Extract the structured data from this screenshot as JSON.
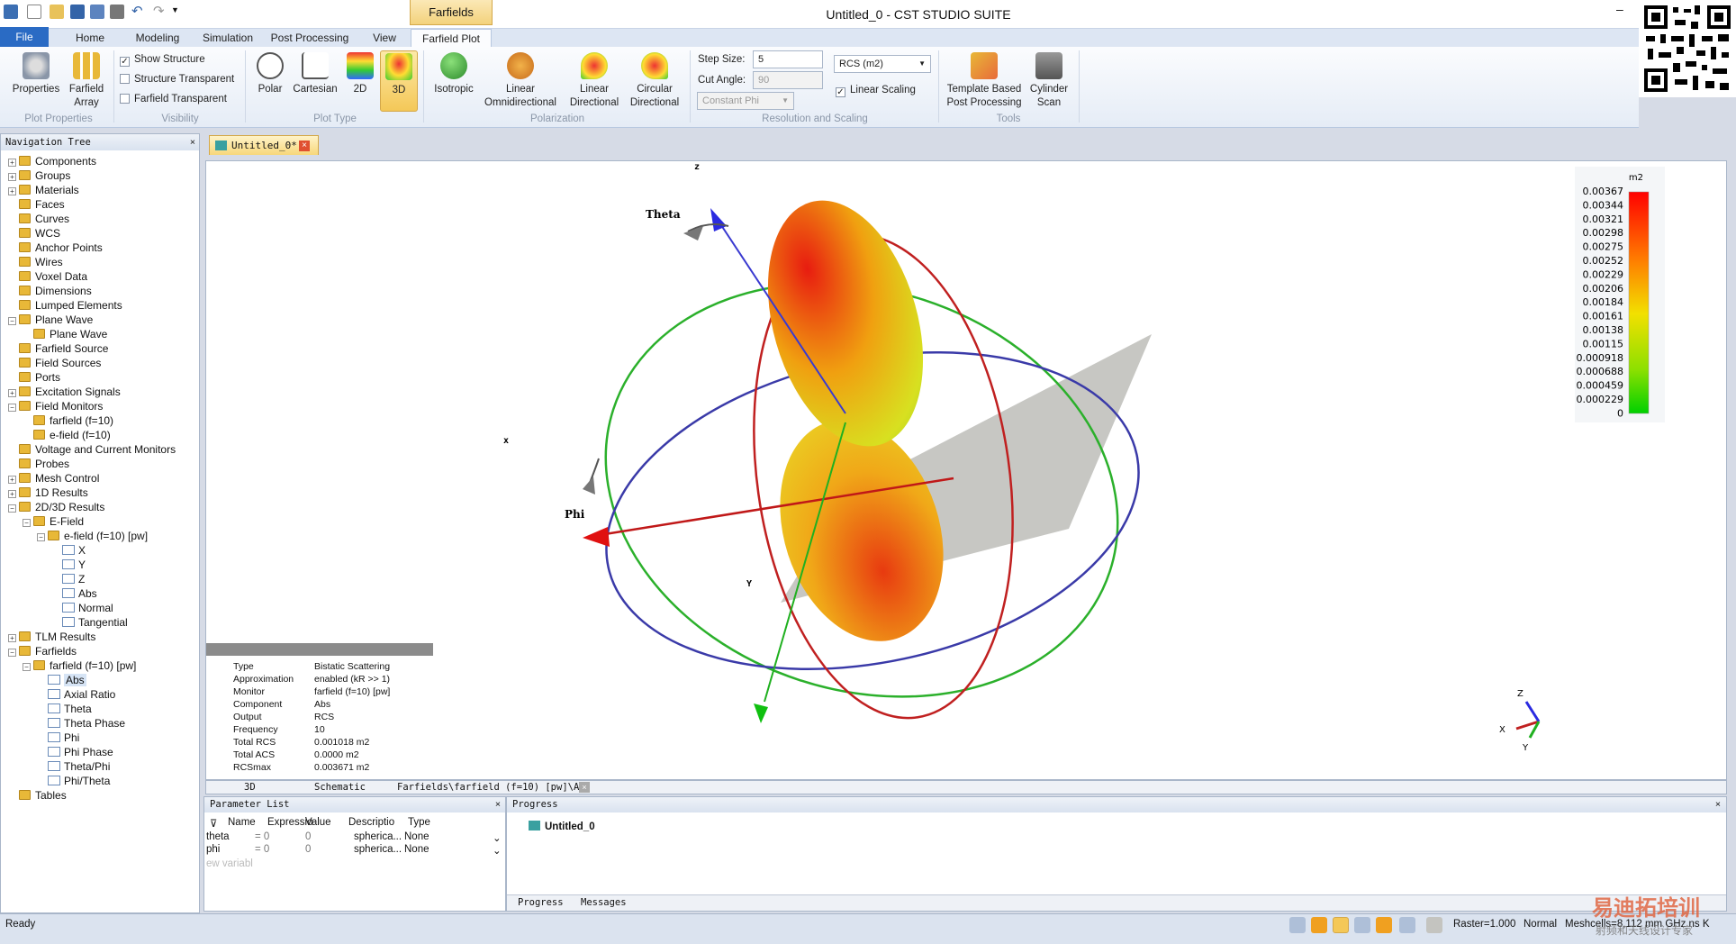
{
  "title_bar": {
    "app_title": "Untitled_0 - CST STUDIO SUITE",
    "context_tab": "Farfields",
    "minimize": "–"
  },
  "menu": {
    "file": "File",
    "tabs": [
      "Home",
      "Modeling",
      "Simulation",
      "Post Processing",
      "View",
      "Farfield Plot"
    ],
    "active": "Farfield Plot"
  },
  "ribbon": {
    "plot_properties": {
      "buttons": [
        "Properties",
        "Farfield Array"
      ],
      "group": "Plot Properties"
    },
    "visibility": {
      "checks": [
        {
          "label": "Show Structure",
          "checked": true
        },
        {
          "label": "Structure Transparent",
          "checked": false
        },
        {
          "label": "Farfield Transparent",
          "checked": false
        }
      ],
      "group": "Visibility"
    },
    "plot_type": {
      "buttons": [
        "Polar",
        "Cartesian",
        "2D",
        "3D"
      ],
      "active": "3D",
      "group": "Plot Type"
    },
    "polarization": {
      "buttons": [
        "Isotropic",
        "Linear Omnidirectional",
        "Linear Directional",
        "Circular Directional"
      ],
      "group": "Polarization"
    },
    "resolution": {
      "step_label": "Step Size:",
      "step_value": "5",
      "cut_label": "Cut Angle:",
      "cut_value": "90",
      "constant": "Constant Phi",
      "unit": "RCS (m2)",
      "linear_scaling": "Linear Scaling",
      "linear_checked": true,
      "group": "Resolution and Scaling"
    },
    "tools": {
      "buttons": [
        "Template Based Post Processing",
        "Cylinder Scan"
      ],
      "group": "Tools"
    }
  },
  "nav": {
    "title": "Navigation Tree",
    "items": [
      {
        "t": "Components",
        "l": 0,
        "e": "+"
      },
      {
        "t": "Groups",
        "l": 0,
        "e": "+"
      },
      {
        "t": "Materials",
        "l": 0,
        "e": "+"
      },
      {
        "t": "Faces",
        "l": 0,
        "e": ""
      },
      {
        "t": "Curves",
        "l": 0,
        "e": ""
      },
      {
        "t": "WCS",
        "l": 0,
        "e": ""
      },
      {
        "t": "Anchor Points",
        "l": 0,
        "e": ""
      },
      {
        "t": "Wires",
        "l": 0,
        "e": ""
      },
      {
        "t": "Voxel Data",
        "l": 0,
        "e": ""
      },
      {
        "t": "Dimensions",
        "l": 0,
        "e": ""
      },
      {
        "t": "Lumped Elements",
        "l": 0,
        "e": ""
      },
      {
        "t": "Plane Wave",
        "l": 0,
        "e": "-"
      },
      {
        "t": "Plane Wave",
        "l": 1,
        "e": ""
      },
      {
        "t": "Farfield Source",
        "l": 0,
        "e": ""
      },
      {
        "t": "Field Sources",
        "l": 0,
        "e": ""
      },
      {
        "t": "Ports",
        "l": 0,
        "e": ""
      },
      {
        "t": "Excitation Signals",
        "l": 0,
        "e": "+"
      },
      {
        "t": "Field Monitors",
        "l": 0,
        "e": "-"
      },
      {
        "t": "farfield (f=10)",
        "l": 1,
        "e": ""
      },
      {
        "t": "e-field (f=10)",
        "l": 1,
        "e": ""
      },
      {
        "t": "Voltage and Current Monitors",
        "l": 0,
        "e": ""
      },
      {
        "t": "Probes",
        "l": 0,
        "e": ""
      },
      {
        "t": "Mesh Control",
        "l": 0,
        "e": "+"
      },
      {
        "t": "1D Results",
        "l": 0,
        "e": "+"
      },
      {
        "t": "2D/3D Results",
        "l": 0,
        "e": "-"
      },
      {
        "t": "E-Field",
        "l": 1,
        "e": "-"
      },
      {
        "t": "e-field (f=10) [pw]",
        "l": 2,
        "e": "-"
      },
      {
        "t": "X",
        "l": 3,
        "e": ""
      },
      {
        "t": "Y",
        "l": 3,
        "e": ""
      },
      {
        "t": "Z",
        "l": 3,
        "e": ""
      },
      {
        "t": "Abs",
        "l": 3,
        "e": ""
      },
      {
        "t": "Normal",
        "l": 3,
        "e": ""
      },
      {
        "t": "Tangential",
        "l": 3,
        "e": ""
      },
      {
        "t": "TLM Results",
        "l": 0,
        "e": "+"
      },
      {
        "t": "Farfields",
        "l": 0,
        "e": "-"
      },
      {
        "t": "farfield (f=10) [pw]",
        "l": 1,
        "e": "-"
      },
      {
        "t": "Abs",
        "l": 2,
        "e": "",
        "sel": true
      },
      {
        "t": "Axial Ratio",
        "l": 2,
        "e": ""
      },
      {
        "t": "Theta",
        "l": 2,
        "e": ""
      },
      {
        "t": "Theta Phase",
        "l": 2,
        "e": ""
      },
      {
        "t": "Phi",
        "l": 2,
        "e": ""
      },
      {
        "t": "Phi Phase",
        "l": 2,
        "e": ""
      },
      {
        "t": "Theta/Phi",
        "l": 2,
        "e": ""
      },
      {
        "t": "Phi/Theta",
        "l": 2,
        "e": ""
      },
      {
        "t": "Tables",
        "l": 0,
        "e": ""
      }
    ]
  },
  "doc_tab": "Untitled_0*",
  "scene": {
    "axis_z": "z",
    "axis_x": "x",
    "axis_y": "Y",
    "theta": "Theta",
    "phi": "Phi",
    "mini_z": "Z",
    "mini_x": "X",
    "mini_y": "Y"
  },
  "legend": {
    "unit": "m2",
    "values": [
      "0.00367",
      "0.00344",
      "0.00321",
      "0.00298",
      "0.00275",
      "0.00252",
      "0.00229",
      "0.00206",
      "0.00184",
      "0.00161",
      "0.00138",
      "0.00115",
      "0.000918",
      "0.000688",
      "0.000459",
      "0.000229",
      "0"
    ]
  },
  "info": [
    [
      "Type",
      "Bistatic Scattering"
    ],
    [
      "Approximation",
      "enabled (kR >> 1)"
    ],
    [
      "Monitor",
      "farfield (f=10) [pw]"
    ],
    [
      "Component",
      "Abs"
    ],
    [
      "Output",
      "RCS"
    ],
    [
      "Frequency",
      "10"
    ],
    [
      "Total RCS",
      "0.001018 m2"
    ],
    [
      "Total ACS",
      "0.0000 m2"
    ],
    [
      "RCSmax",
      "0.003671 m2"
    ]
  ],
  "view_tabs": [
    "3D",
    "Schematic",
    "Farfields\\farfield (f=10) [pw]\\Abs"
  ],
  "params": {
    "title": "Parameter List",
    "headers": [
      "Name",
      "Expressio",
      "Value",
      "Descriptio",
      "Type"
    ],
    "rows": [
      [
        "theta",
        "= 0",
        "0",
        "spherica...",
        "None"
      ],
      [
        "phi",
        "= 0",
        "0",
        "spherica...",
        "None"
      ]
    ],
    "new": "ew variabl"
  },
  "progress": {
    "title": "Progress",
    "item": "Untitled_0",
    "tabs": [
      "Progress",
      "Messages"
    ]
  },
  "status": {
    "ready": "Ready",
    "raster": "Raster=1.000",
    "mode": "Normal",
    "mesh": "Meshcells=8,112  mm  GHz  ns  K",
    "watermark": "易迪拓培训",
    "watermark2": "射频和天线设计专家"
  },
  "colors": {
    "accent": "#2a6bc4",
    "context": "#f3d27c"
  }
}
